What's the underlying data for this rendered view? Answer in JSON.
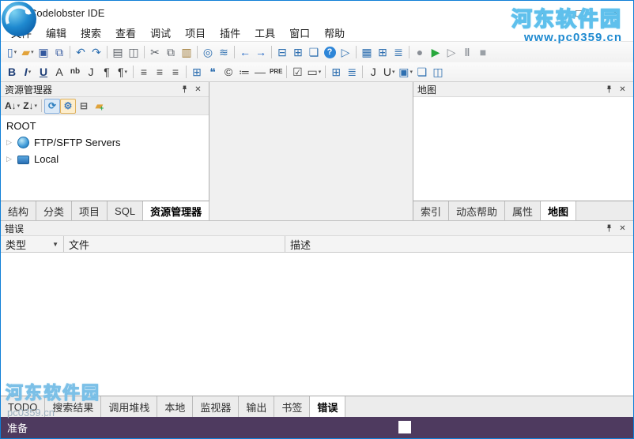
{
  "window": {
    "title": "Codelobster IDE",
    "minimize": "–",
    "maximize": "□",
    "close": "✕"
  },
  "watermark": {
    "top_name": "河东软件园",
    "top_url": "www.pc0359.cn",
    "bottom_name": "河东软件园",
    "bottom_url": "pc0359.cn"
  },
  "menu": {
    "items": [
      "文件",
      "编辑",
      "搜索",
      "查看",
      "调试",
      "项目",
      "插件",
      "工具",
      "窗口",
      "帮助"
    ]
  },
  "toolbar1": [
    {
      "name": "new-file-icon",
      "glyph": "▯",
      "color": "#3a6fb5",
      "chevron": true
    },
    {
      "name": "open-folder-icon",
      "glyph": "▰",
      "color": "#e2a33b",
      "chevron": true
    },
    {
      "name": "save-icon",
      "glyph": "▣",
      "color": "#33589e"
    },
    {
      "name": "save-all-icon",
      "glyph": "⧉",
      "color": "#33589e"
    },
    {
      "sep": true
    },
    {
      "name": "undo-icon",
      "glyph": "↶",
      "color": "#2e6fb0"
    },
    {
      "name": "redo-icon",
      "glyph": "↷",
      "color": "#2e6fb0"
    },
    {
      "sep": true
    },
    {
      "name": "print-icon",
      "glyph": "▤",
      "color": "#5a5f66"
    },
    {
      "name": "print-preview-icon",
      "glyph": "◫",
      "color": "#5a5f66"
    },
    {
      "sep": true
    },
    {
      "name": "cut-icon",
      "glyph": "✂",
      "color": "#5a5f66"
    },
    {
      "name": "copy-icon",
      "glyph": "⧉",
      "color": "#5a5f66"
    },
    {
      "name": "paste-icon",
      "glyph": "▥",
      "color": "#a07a35"
    },
    {
      "sep": true
    },
    {
      "name": "find-icon",
      "glyph": "◎",
      "color": "#2e6fb0"
    },
    {
      "name": "special-chars-icon",
      "glyph": "≋",
      "color": "#2e6fb0"
    },
    {
      "sep": true
    },
    {
      "name": "back-icon",
      "glyph": "←",
      "color": "#1d63c4",
      "cls": "bold"
    },
    {
      "name": "forward-icon",
      "glyph": "→",
      "color": "#1d63c4",
      "cls": "bold"
    },
    {
      "sep": true
    },
    {
      "name": "split-horizontal-icon",
      "glyph": "⊟",
      "color": "#2e6fb0"
    },
    {
      "name": "split-vertical-icon",
      "glyph": "⊞",
      "color": "#2e6fb0"
    },
    {
      "name": "browser-window-icon",
      "glyph": "❏",
      "color": "#2e6fb0"
    },
    {
      "name": "help-icon",
      "glyph": "?",
      "cls": "help"
    },
    {
      "name": "run-in-browser-icon",
      "glyph": "▷",
      "color": "#2e6fb0"
    },
    {
      "sep": true
    },
    {
      "name": "panels-icon",
      "glyph": "▦",
      "color": "#2e6fb0"
    },
    {
      "name": "table-view-icon",
      "glyph": "⊞",
      "color": "#2e6fb0"
    },
    {
      "name": "list-view-icon",
      "glyph": "≣",
      "color": "#2e6fb0"
    },
    {
      "sep": true
    },
    {
      "name": "record-icon",
      "glyph": "●",
      "color": "#8a8f96"
    },
    {
      "name": "run-debug-icon",
      "glyph": "▶",
      "color": "#27a83c"
    },
    {
      "name": "step-icon",
      "glyph": "▷",
      "color": "#8a8f96"
    },
    {
      "name": "pause-icon",
      "glyph": "‖",
      "color": "#8a8f96",
      "cls": "bold"
    },
    {
      "name": "stop-icon",
      "glyph": "■",
      "color": "#9aa0a6"
    }
  ],
  "toolbar2": [
    {
      "name": "bold-icon",
      "glyph": "B",
      "color": "#1f3f77",
      "cls": "bold"
    },
    {
      "name": "italic-icon",
      "glyph": "I",
      "color": "#1f3f77",
      "cls": "italic",
      "chevron": true
    },
    {
      "name": "underline-icon",
      "glyph": "U",
      "color": "#1f3f77",
      "cls": "underline"
    },
    {
      "name": "font-icon",
      "glyph": "A",
      "color": "#333333"
    },
    {
      "name": "nbsp-icon",
      "glyph": "nb",
      "color": "#333333",
      "cls": "small"
    },
    {
      "name": "anchor-icon",
      "glyph": "J",
      "color": "#333333"
    },
    {
      "name": "paragraph-icon",
      "glyph": "¶",
      "color": "#333333"
    },
    {
      "name": "paragraph-style-icon",
      "glyph": "¶",
      "color": "#333333",
      "chevron": true
    },
    {
      "sep": true
    },
    {
      "name": "align-left-icon",
      "glyph": "≡",
      "color": "#444444"
    },
    {
      "name": "align-center-icon",
      "glyph": "≡",
      "color": "#444444"
    },
    {
      "name": "align-right-icon",
      "glyph": "≡",
      "color": "#444444"
    },
    {
      "sep": true
    },
    {
      "name": "table-icon",
      "glyph": "⊞",
      "color": "#2e6fb0"
    },
    {
      "name": "comment-icon",
      "glyph": "❝",
      "color": "#2e6fb0"
    },
    {
      "name": "copyright-icon",
      "glyph": "©",
      "color": "#333333"
    },
    {
      "name": "list-icon",
      "glyph": "≔",
      "color": "#444444"
    },
    {
      "name": "horizontal-rule-icon",
      "glyph": "—",
      "color": "#444444"
    },
    {
      "name": "pre-icon",
      "glyph": "PRE",
      "color": "#333333",
      "cls": "tiny"
    },
    {
      "sep": true
    },
    {
      "name": "checkbox-icon",
      "glyph": "☑",
      "color": "#444444"
    },
    {
      "name": "dropdown-list-icon",
      "glyph": "▭",
      "color": "#444444",
      "chevron": true
    },
    {
      "sep": true
    },
    {
      "name": "grid-icon",
      "glyph": "⊞",
      "color": "#2e6fb0"
    },
    {
      "name": "rows-icon",
      "glyph": "≣",
      "color": "#2e6fb0"
    },
    {
      "sep": true
    },
    {
      "name": "script-icon",
      "glyph": "J",
      "color": "#333333"
    },
    {
      "name": "link-underline-icon",
      "glyph": "U",
      "color": "#333333",
      "chevron": true
    },
    {
      "name": "highlight-icon",
      "glyph": "▣",
      "color": "#2e6fb0",
      "chevron": true
    },
    {
      "name": "frame-icon",
      "glyph": "❏",
      "color": "#2e6fb0"
    },
    {
      "name": "split-icon",
      "glyph": "◫",
      "color": "#2e6fb0"
    }
  ],
  "explorer": {
    "title": "资源管理器",
    "toolbar": [
      {
        "name": "sort-ascending-icon",
        "glyph": "A↓",
        "color": "#333333",
        "chevron": true
      },
      {
        "name": "sort-descending-icon",
        "glyph": "Z↓",
        "color": "#333333",
        "chevron": true
      },
      {
        "sep": true
      },
      {
        "name": "refresh-icon",
        "glyph": "⟳",
        "color": "#2e7fbf",
        "btncls": "pressed-blue"
      },
      {
        "name": "settings-gear-icon",
        "glyph": "⚙",
        "color": "#3a7abf",
        "btncls": "pressed-orange"
      },
      {
        "name": "collapse-all-icon",
        "glyph": "⊟",
        "color": "#666666"
      },
      {
        "name": "new-folder-icon",
        "glyph": "▰",
        "color": "#e0a23a",
        "plus": true
      }
    ],
    "tree": [
      {
        "label": "ROOT",
        "icon": "",
        "expand": ""
      },
      {
        "label": "FTP/SFTP Servers",
        "icon": "globe",
        "expand": "▷"
      },
      {
        "label": "Local",
        "icon": "drive",
        "expand": "▷"
      }
    ],
    "tabs": [
      "结构",
      "分类",
      "项目",
      "SQL",
      "资源管理器"
    ],
    "active_tab": "资源管理器"
  },
  "map": {
    "title": "地图",
    "tabs": [
      "索引",
      "动态帮助",
      "属性",
      "地图"
    ],
    "active_tab": "地图"
  },
  "errors": {
    "title": "错误",
    "columns": [
      "类型",
      "文件",
      "描述"
    ],
    "rows": []
  },
  "bottom_tabs": {
    "tabs": [
      "TODO",
      "搜索结果",
      "调用堆栈",
      "本地",
      "监视器",
      "输出",
      "书签",
      "错误"
    ],
    "active_tab": "错误"
  },
  "status": {
    "ready": "准备"
  }
}
